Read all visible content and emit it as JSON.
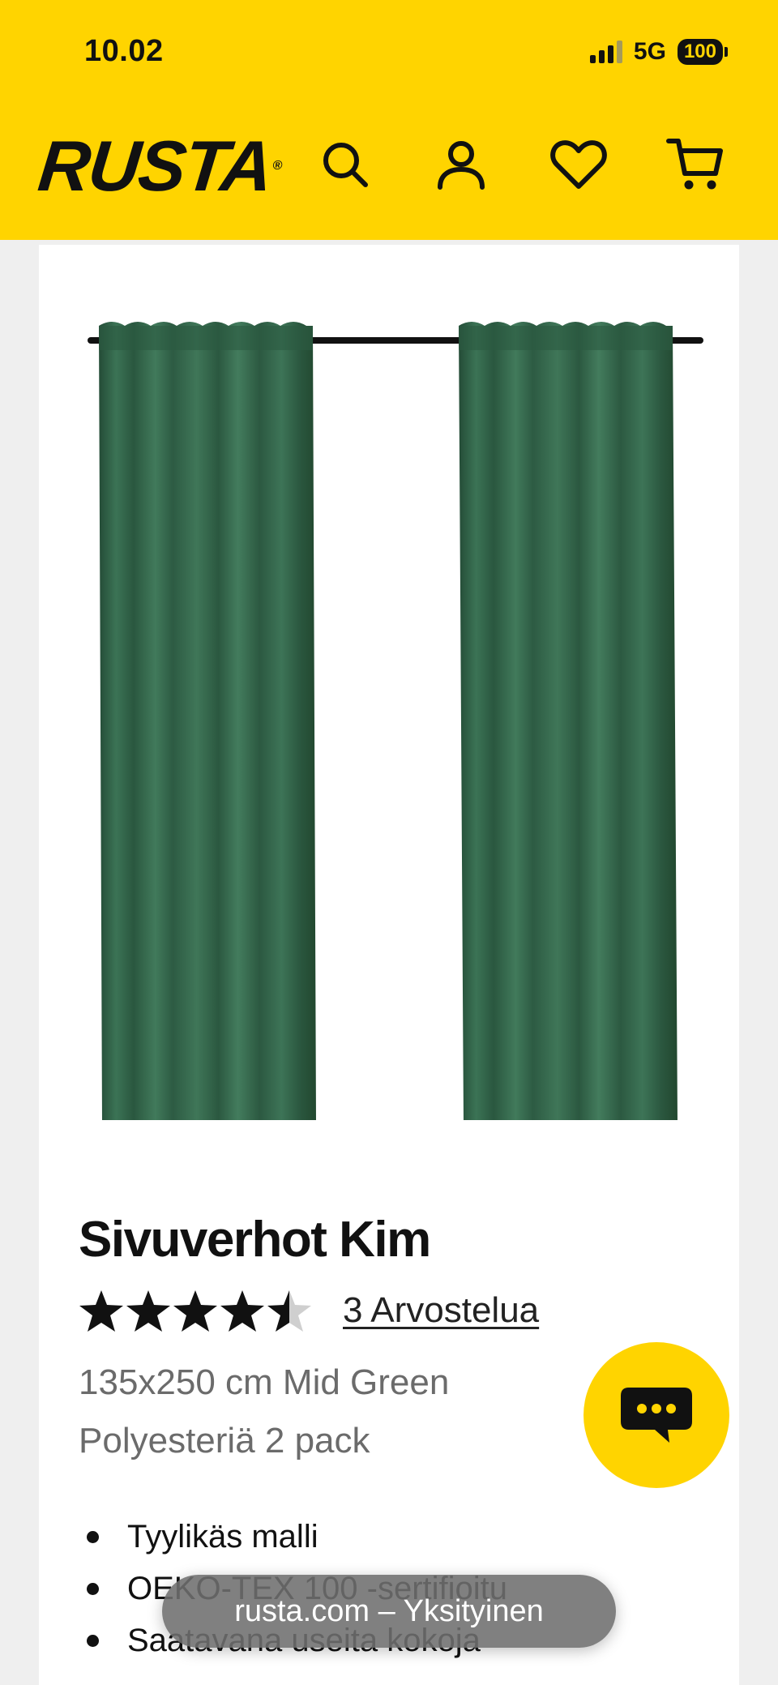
{
  "status_bar": {
    "time": "10.02",
    "network": "5G",
    "battery": "100",
    "signal_bars_active": 3,
    "signal_bars_total": 4
  },
  "header": {
    "logo_text": "RUSTA",
    "logo_registered": "®",
    "icons": [
      "search-icon",
      "account-icon",
      "wishlist-heart-icon",
      "cart-icon"
    ],
    "background_color": "#ffd400"
  },
  "product": {
    "image_alt": "Sivuverhot Kim",
    "title": "Sivuverhot Kim",
    "rating_value": 4.5,
    "rating_max": 5,
    "reviews_label": "3 Arvostelua",
    "subtitle": "135x250 cm Mid Green Polyesteriä 2 pack",
    "features": [
      "Tyylikäs malli",
      "OEKO-TEX 100 -sertifioitu",
      "Saatavana useita kokoja"
    ],
    "curtain_color": "#2f6046"
  },
  "chat": {
    "icon": "chat-bubble-icon"
  },
  "browser": {
    "url_label": "rusta.com – Yksityinen"
  }
}
